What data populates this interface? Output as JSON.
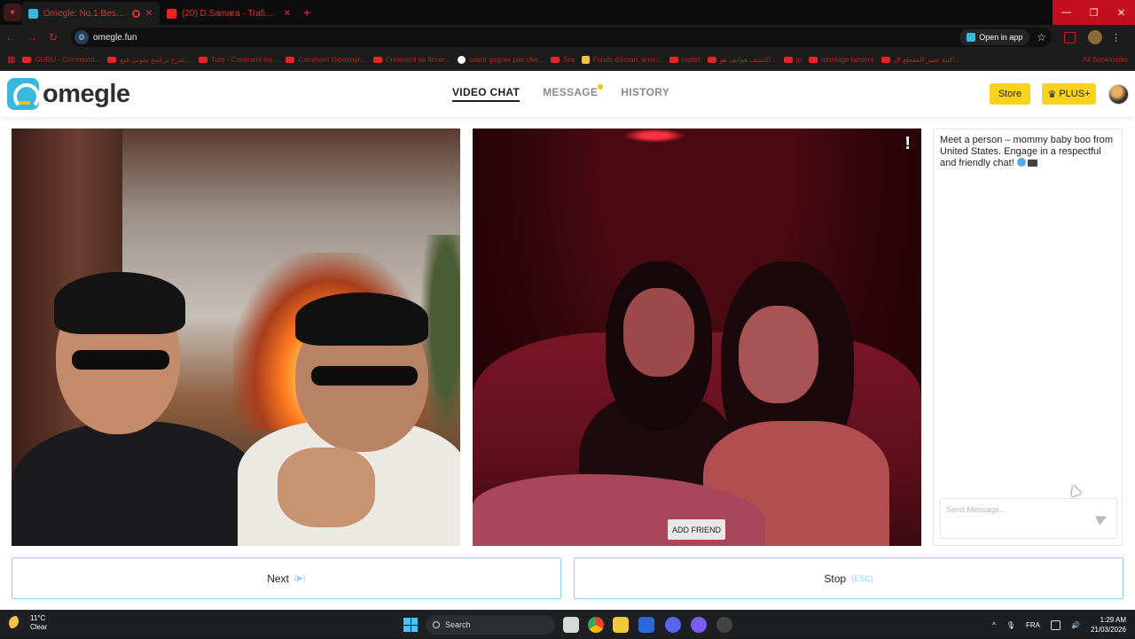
{
  "browser": {
    "tabs": [
      {
        "title": "Omegle: No.1 Best Random ...",
        "type": "omegle",
        "active": true
      },
      {
        "title": "(20) D.Samara - Trafiquant (Cl...",
        "type": "youtube",
        "active": false
      }
    ],
    "url": "omegle.fun",
    "open_in_app": "Open in app",
    "bookmarks": [
      {
        "label": "GURU - Communit...",
        "icon": "youtube"
      },
      {
        "label": "شرح برنامج سوني فيغ...",
        "icon": "youtube"
      },
      {
        "label": "Tuto - Comment ins...",
        "icon": "youtube"
      },
      {
        "label": "Comment t'abonner...",
        "icon": "youtube"
      },
      {
        "label": "Comment se filmer...",
        "icon": "youtube"
      },
      {
        "label": "sourir gagner pas che...",
        "icon": "google"
      },
      {
        "label": "Sra",
        "icon": "youtube"
      },
      {
        "label": "Fonds d'écran, arrer...",
        "icon": "hub"
      },
      {
        "label": "tostist",
        "icon": "youtube"
      },
      {
        "label": "اكتشف هواتف هو...",
        "icon": "youtube"
      },
      {
        "label": "jp",
        "icon": "youtube"
      },
      {
        "label": "montage lumiere",
        "icon": "youtube"
      },
      {
        "label": "اكتبة تغيير المقطع ال...",
        "icon": "youtube"
      }
    ],
    "all_bookmarks": "All Bookmarks"
  },
  "site": {
    "logo_text": "omegle",
    "nav": [
      {
        "label": "VIDEO CHAT",
        "active": true,
        "dot": false
      },
      {
        "label": "MESSAGE",
        "active": false,
        "dot": true
      },
      {
        "label": "HISTORY",
        "active": false,
        "dot": false
      }
    ],
    "store_label": "Store",
    "plus_label": "PLUS+",
    "accent_color": "#3bb6dc",
    "button_yellow": "#f7d31b"
  },
  "remote": {
    "report_label": "!",
    "add_friend_label": "ADD FRIEND"
  },
  "chat": {
    "greeting": "Meet a person – mommy baby boo from United States. Engage in a respectful and friendly chat!",
    "input_placeholder": "Send Message..."
  },
  "controls": {
    "next_label": "Next",
    "next_hint": "(▶)",
    "stop_label": "Stop",
    "stop_hint": "(ESC)"
  },
  "taskbar": {
    "temperature": "11°C",
    "condition": "Clear",
    "search_label": "Search",
    "language": "FRA",
    "time": "1:29 AM",
    "date": "21/03/2026"
  }
}
